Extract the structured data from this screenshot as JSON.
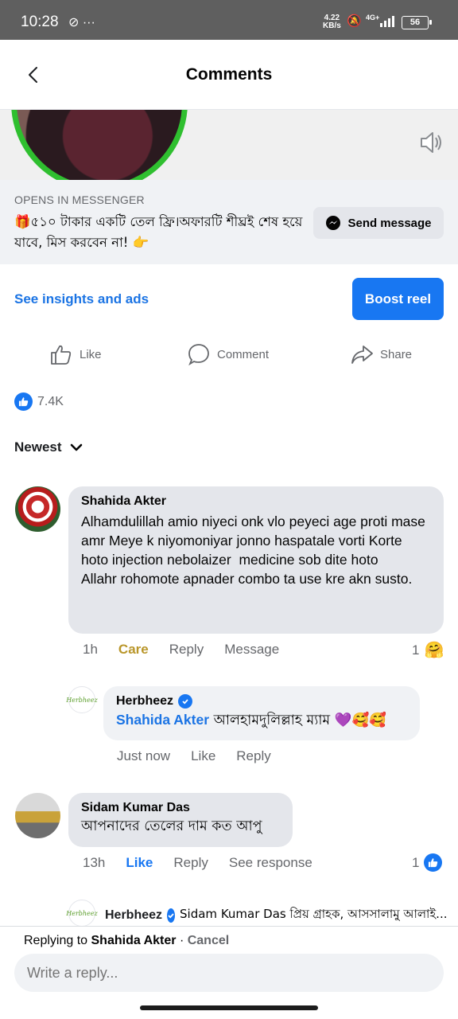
{
  "status_bar": {
    "time": "10:28",
    "speed_value": "4.22",
    "speed_unit": "KB/s",
    "network": "4G+",
    "battery": "56"
  },
  "header": {
    "title": "Comments"
  },
  "cta": {
    "label": "OPENS IN MESSENGER",
    "text": "🎁৫১০ টাকার একটি তেল ফ্রি।অফারটি শীঘ্রই শেষ হয়ে যাবে, মিস করবেন না! 👉",
    "button": "Send message"
  },
  "insights_link": "See insights and ads",
  "boost_button": "Boost reel",
  "actions": {
    "like": "Like",
    "comment": "Comment",
    "share": "Share"
  },
  "reactions_count": "7.4K",
  "sort_label": "Newest",
  "comments": [
    {
      "author": "Shahida Akter",
      "text": "Alhamdulillah amio niyeci onk vlo peyeci age proti mase amr Meye k niyomoniyar jonno haspatale vorti Korte hoto injection nebolaizer  medicine sob dite hoto\nAllahr rohomote apnader combo ta use kre akn susto.",
      "time": "1h",
      "reaction_label": "Care",
      "reply_label": "Reply",
      "message_label": "Message",
      "reaction_count": "1",
      "reply": {
        "author": "Herbheez",
        "mention": "Shahida Akter",
        "text": " আলহামদুলিল্লাহ ম্যাম 💜🥰🥰",
        "time": "Just now",
        "like_label": "Like",
        "reply_label": "Reply"
      }
    },
    {
      "author": "Sidam Kumar Das",
      "text": "আপনাদের তেলের দাম কত আপু",
      "time": "13h",
      "like_label": "Like",
      "reply_label": "Reply",
      "see_response_label": "See response",
      "reaction_count": "1",
      "reply_preview": {
        "author": "Herbheez",
        "text": "Sidam Kumar Das প্রিয় গ্রাহক, আসসালামু আলাই..."
      }
    }
  ],
  "logo_text": "Herbheez",
  "reply_bar": {
    "prefix": "Replying to ",
    "name": "Shahida Akter",
    "separator": " · ",
    "cancel": "Cancel",
    "placeholder": "Write a reply..."
  },
  "colors": {
    "accent": "#1877f2",
    "care": "#b9962a",
    "bubble": "#e4e6eb"
  }
}
